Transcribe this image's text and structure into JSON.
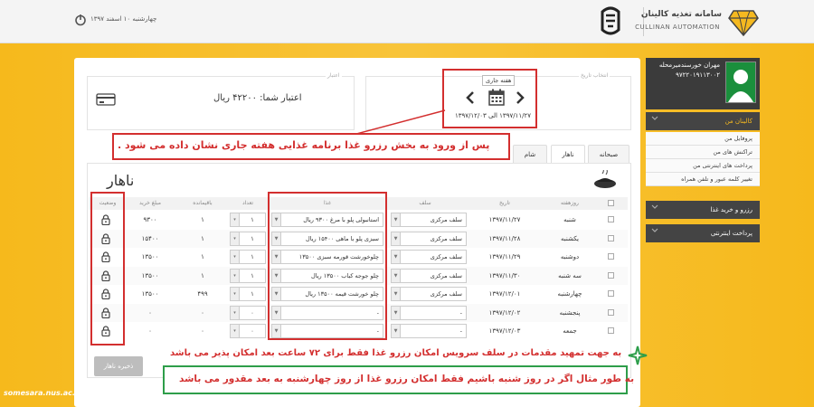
{
  "header": {
    "brand_fa": "سامانه تغذیه کالینان",
    "brand_en": "CULLINAN AUTOMATION",
    "date_text": "چهارشنبه ۱۰ اسفند ۱۳۹۷"
  },
  "sidebar": {
    "user_name": "مهران خورسندمیرمحله",
    "user_id": "۹۷۲۲۰۱۹۱۱۳۰۰۲",
    "menu": [
      {
        "label": "کالینان من",
        "type": "head"
      },
      {
        "label": "پروفایل من",
        "type": "item"
      },
      {
        "label": "تراکنش های من",
        "type": "item"
      },
      {
        "label": "پرداخت های اینترنتی من",
        "type": "item"
      },
      {
        "label": "تغییر کلمه عبور و تلفن همراه",
        "type": "item"
      },
      {
        "label": "رزرو و خرید غذا",
        "type": "head"
      },
      {
        "label": "پرداخت اینترنتی",
        "type": "head"
      }
    ]
  },
  "credit": {
    "legend": "اعتبار",
    "text": "اعتبار شما: ۴۲۲۰۰ ریال"
  },
  "week": {
    "legend": "انتخاب تاریخ",
    "tooltip": "هفته جاری",
    "range": "۱۳۹۷/۱۱/۲۷ الی ۱۳۹۷/۱۲/۰۳"
  },
  "annotations": {
    "top": "پس از ورود به بخش رزرو غذا برنامه غذایی هفته جاری نشان داده می شود .",
    "middle": "به جهت تمهید مقدمات در سلف سرویس امکان رزرو  غذا فقط برای ۷۲ ساعت بعد امکان پذیر می باشد",
    "bottom": "به طور مثال اگر در روز شنبه باشیم  فقط امکان رزرو غذا از روز چهارشنبه به بعد مقدور می باشد"
  },
  "tabs": [
    "صبحانه",
    "ناهار",
    "شام"
  ],
  "section_title": "ناهار",
  "table": {
    "headers": {
      "day": "روزهفته",
      "date": "تاریخ",
      "self": "سلف",
      "food": "غذا",
      "count": "تعداد",
      "remain": "باقیمانده",
      "price": "مبلغ خرید",
      "status": "وضعیت"
    },
    "rows": [
      {
        "day": "شنبه",
        "date": "۱۳۹۷/۱۱/۲۷",
        "self": "سلف مرکزی",
        "food": "استانبولی پلو با مرغ ۹۳۰۰ ریال",
        "count": "۱",
        "remain": "۱",
        "price": "۹۳۰۰"
      },
      {
        "day": "یکشنبه",
        "date": "۱۳۹۷/۱۱/۲۸",
        "self": "سلف مرکزی",
        "food": "سبزی پلو با ماهی ۱۵۴۰۰ ریال",
        "count": "۱",
        "remain": "۱",
        "price": "۱۵۴۰۰"
      },
      {
        "day": "دوشنبه",
        "date": "۱۳۹۷/۱۱/۲۹",
        "self": "سلف مرکزی",
        "food": "چلوخورشت قورمه سبزی ۱۳۵۰۰",
        "count": "۱",
        "remain": "۱",
        "price": "۱۳۵۰۰"
      },
      {
        "day": "سه شنبه",
        "date": "۱۳۹۷/۱۱/۳۰",
        "self": "سلف مرکزی",
        "food": "چلو جوجه کباب ۱۳۵۰۰ ریال",
        "count": "۱",
        "remain": "۱",
        "price": "۱۳۵۰۰"
      },
      {
        "day": "چهارشنبه",
        "date": "۱۳۹۷/۱۲/۰۱",
        "self": "سلف مرکزی",
        "food": "چلو خورشت قیمه ۱۳۵۰۰ ریال",
        "count": "۱",
        "remain": "۴۹۹",
        "price": "۱۳۵۰۰"
      },
      {
        "day": "پنجشنبه",
        "date": "۱۳۹۷/۱۲/۰۲",
        "self": "-",
        "food": "-",
        "count": "۰",
        "remain": "۰",
        "price": "۰"
      },
      {
        "day": "جمعه",
        "date": "۱۳۹۷/۱۲/۰۳",
        "self": "-",
        "food": "-",
        "count": "۰",
        "remain": "۰",
        "price": "۰"
      }
    ]
  },
  "save_button": "ذخیره ناهار",
  "footer_site": "somesara.nus.ac.ir"
}
